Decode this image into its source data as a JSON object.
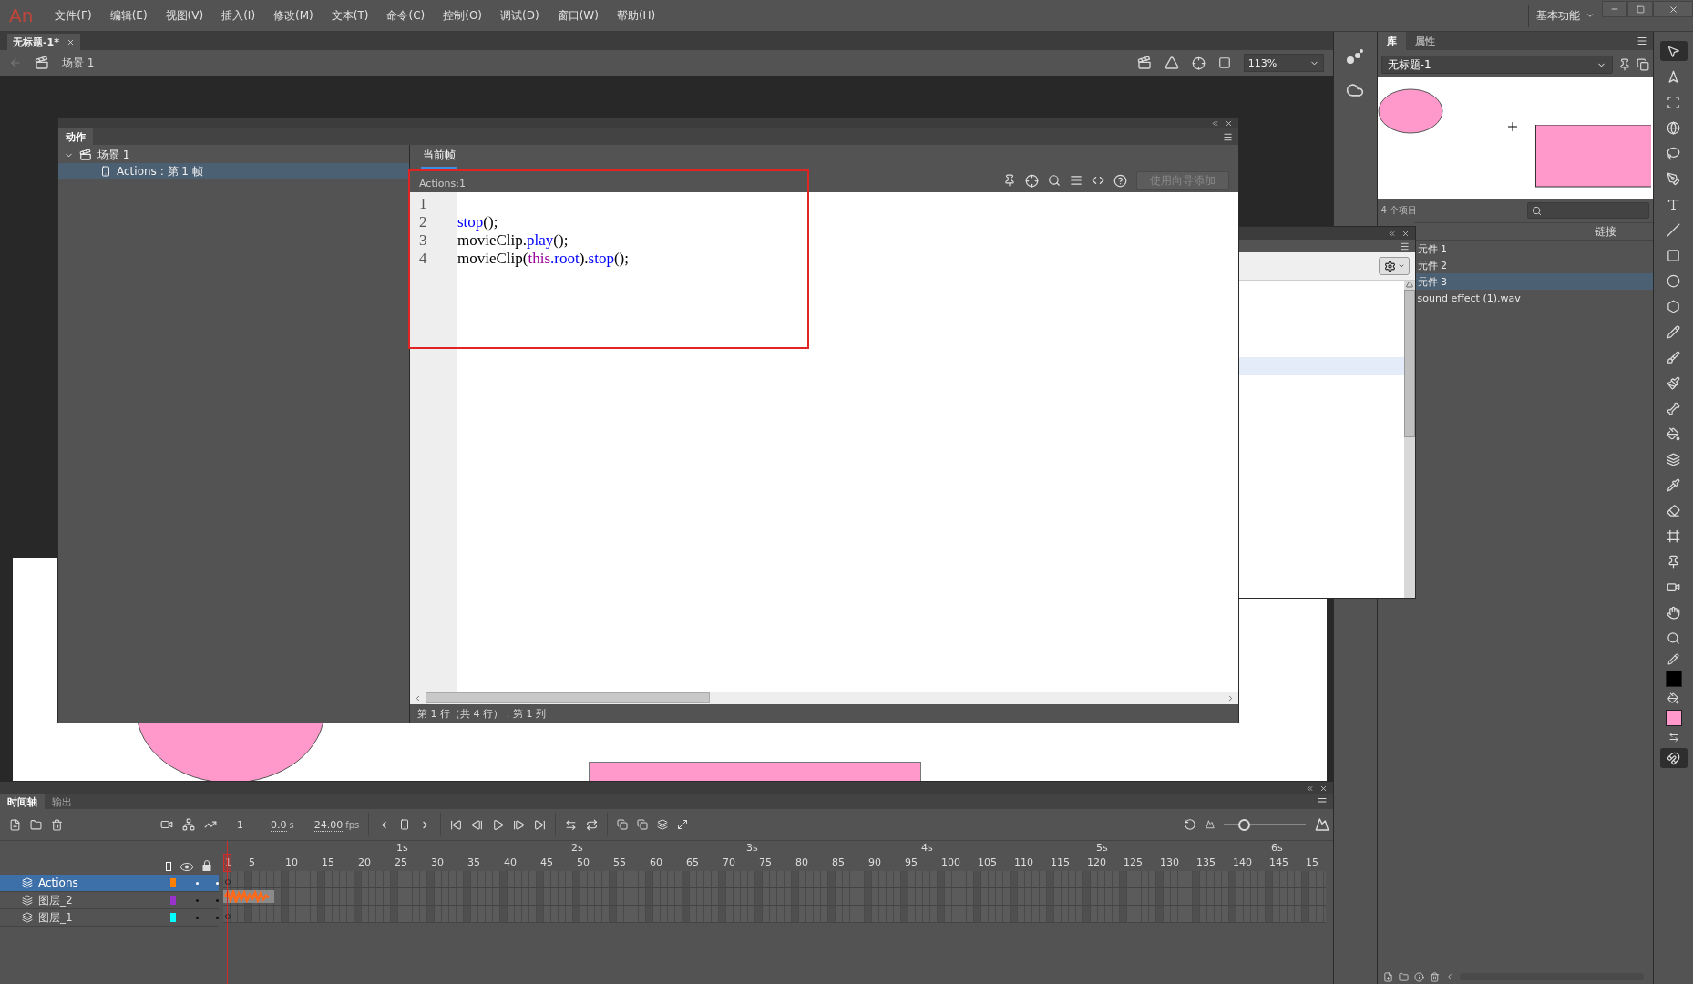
{
  "menu_bar": {
    "logo": "An",
    "items": [
      "文件(F)",
      "编辑(E)",
      "视图(V)",
      "插入(I)",
      "修改(M)",
      "文本(T)",
      "命令(C)",
      "控制(O)",
      "调试(D)",
      "窗口(W)",
      "帮助(H)"
    ],
    "workspace": "基本功能"
  },
  "document_tabs": [
    {
      "label": "无标题-1*",
      "selected": true
    }
  ],
  "scene_bar": {
    "scene": "场景 1",
    "zoom": "113%"
  },
  "actions_panel": {
    "title": "动作",
    "tree": [
      {
        "label": "场景 1",
        "expanded": true,
        "selected": false,
        "children": [
          {
            "label": "Actions : 第 1 帧",
            "selected": true
          }
        ]
      }
    ],
    "tab": "当前帧",
    "script_label": "Actions:1",
    "assist_button": "使用向导添加",
    "code": [
      {
        "number": "1"
      },
      {
        "number": "2",
        "tokens": [
          {
            "text": "stop",
            "kind": "method"
          },
          {
            "text": "();",
            "kind": "plain"
          }
        ]
      },
      {
        "number": "3",
        "tokens": [
          {
            "text": "movieClip.",
            "kind": "plain"
          },
          {
            "text": "play",
            "kind": "method"
          },
          {
            "text": "();",
            "kind": "plain"
          }
        ]
      },
      {
        "number": "4",
        "tokens": [
          {
            "text": "movieClip(",
            "kind": "plain"
          },
          {
            "text": "this",
            "kind": "keyword"
          },
          {
            "text": ".root",
            "kind": "method"
          },
          {
            "text": ").",
            "kind": "plain"
          },
          {
            "text": "stop",
            "kind": "method"
          },
          {
            "text": "();",
            "kind": "plain"
          }
        ]
      }
    ],
    "status": "第 1 行（共 4 行），第 1 列"
  },
  "library": {
    "tabs": [
      {
        "label": "库",
        "selected": true
      },
      {
        "label": "属性",
        "selected": false
      }
    ],
    "document": "无标题-1",
    "count": "4 个项目",
    "column": "链接",
    "items": [
      {
        "name": "元件 1",
        "selected": false
      },
      {
        "name": "元件 2",
        "selected": false
      },
      {
        "name": "元件 3",
        "selected": true
      },
      {
        "name": "sound effect (1).wav",
        "selected": false
      }
    ]
  },
  "timeline": {
    "frame_size": {
      "level": 0.25
    },
    "tabs": [
      {
        "label": "时间轴",
        "selected": true
      },
      {
        "label": "输出",
        "selected": false
      }
    ],
    "frame": "1",
    "time": "0.0",
    "time_unit": "s",
    "fps": "24.00",
    "fps_unit": "fps",
    "seconds": [
      "1s",
      "2s",
      "3s",
      "4s",
      "5s",
      "6s"
    ],
    "frame_numbers": [
      "1",
      "5",
      "10",
      "15",
      "20",
      "25",
      "30",
      "35",
      "40",
      "45",
      "50",
      "55",
      "60",
      "65",
      "70",
      "75",
      "80",
      "85",
      "90",
      "95",
      "100",
      "105",
      "110",
      "115",
      "120",
      "125",
      "130",
      "135",
      "140",
      "145",
      "15"
    ],
    "layers": [
      {
        "name": "Actions",
        "selected": true,
        "color": "#ff7f00",
        "kind": "script"
      },
      {
        "name": "图层_2",
        "selected": false,
        "color": "#9933cc",
        "kind": "sound"
      },
      {
        "name": "图层_1",
        "selected": false,
        "color": "#00ffff",
        "kind": "empty"
      }
    ]
  }
}
